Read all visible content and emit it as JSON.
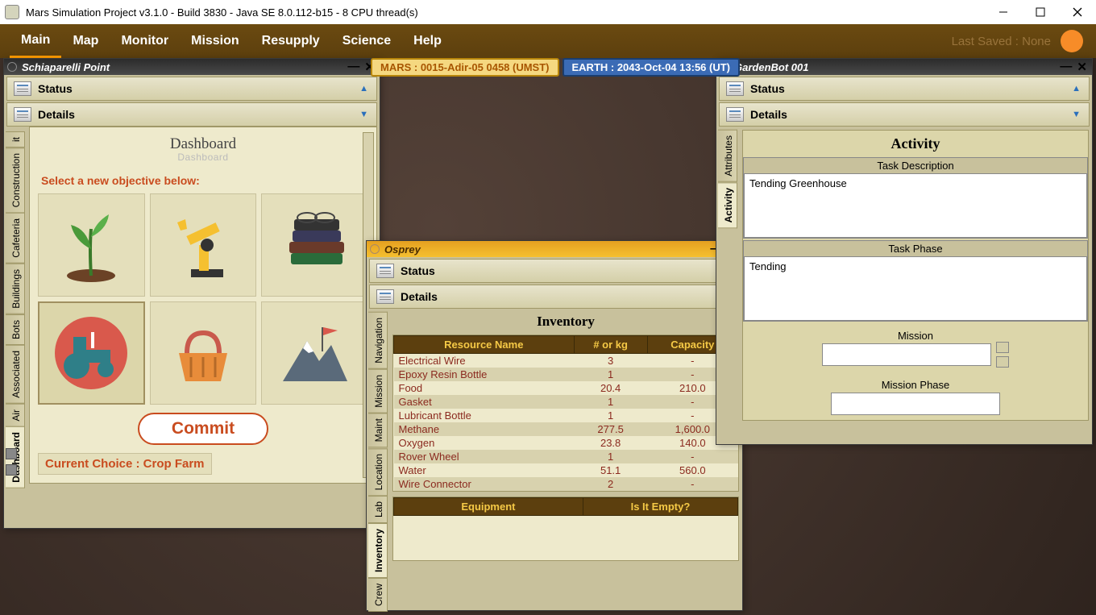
{
  "window": {
    "title": "Mars Simulation Project v3.1.0 - Build 3830 - Java SE 8.0.112-b15 - 8 CPU thread(s)"
  },
  "menubar": {
    "items": [
      "Main",
      "Map",
      "Monitor",
      "Mission",
      "Resupply",
      "Science",
      "Help"
    ],
    "active_index": 0,
    "last_saved": "Last Saved : None"
  },
  "time": {
    "mars": "MARS  :  0015-Adir-05 0458 (UMST)",
    "earth": "EARTH  :  2043-Oct-04  13:56 (UT)"
  },
  "sections": {
    "status": "Status",
    "details": "Details"
  },
  "schiaparelli": {
    "title": "Schiaparelli Point",
    "dashboard_h": "Dashboard",
    "objective_label": "Select a new objective below:",
    "commit": "Commit",
    "current_choice": "Current Choice : Crop Farm",
    "side_tabs": [
      "Dashboard",
      "Air",
      "Associated",
      "Bots",
      "Buildings",
      "Cafeteria",
      "Construction",
      "it"
    ]
  },
  "osprey": {
    "title": "Osprey",
    "inventory_h": "Inventory",
    "side_tabs": [
      "Crew",
      "Inventory",
      "Lab",
      "Location",
      "Maint",
      "Mission",
      "Navigation"
    ],
    "table": {
      "headers": [
        "Resource Name",
        "# or kg",
        "Capacity"
      ],
      "rows": [
        [
          "Electrical Wire",
          "3",
          "-"
        ],
        [
          "Epoxy Resin Bottle",
          "1",
          "-"
        ],
        [
          "Food",
          "20.4",
          "210.0"
        ],
        [
          "Gasket",
          "1",
          "-"
        ],
        [
          "Lubricant Bottle",
          "1",
          "-"
        ],
        [
          "Methane",
          "277.5",
          "1,600.0"
        ],
        [
          "Oxygen",
          "23.8",
          "140.0"
        ],
        [
          "Rover Wheel",
          "1",
          "-"
        ],
        [
          "Water",
          "51.1",
          "560.0"
        ],
        [
          "Wire Connector",
          "2",
          "-"
        ]
      ]
    },
    "equip_headers": [
      "Equipment",
      "Is It Empty?"
    ]
  },
  "gardenbot": {
    "title": "GardenBot 001",
    "side_tabs": [
      "Activity",
      "Attributes"
    ],
    "activity_h": "Activity",
    "task_desc_h": "Task Description",
    "task_desc": "Tending Greenhouse",
    "task_phase_h": "Task Phase",
    "task_phase": "Tending",
    "mission_h": "Mission",
    "mission_phase_h": "Mission Phase"
  }
}
